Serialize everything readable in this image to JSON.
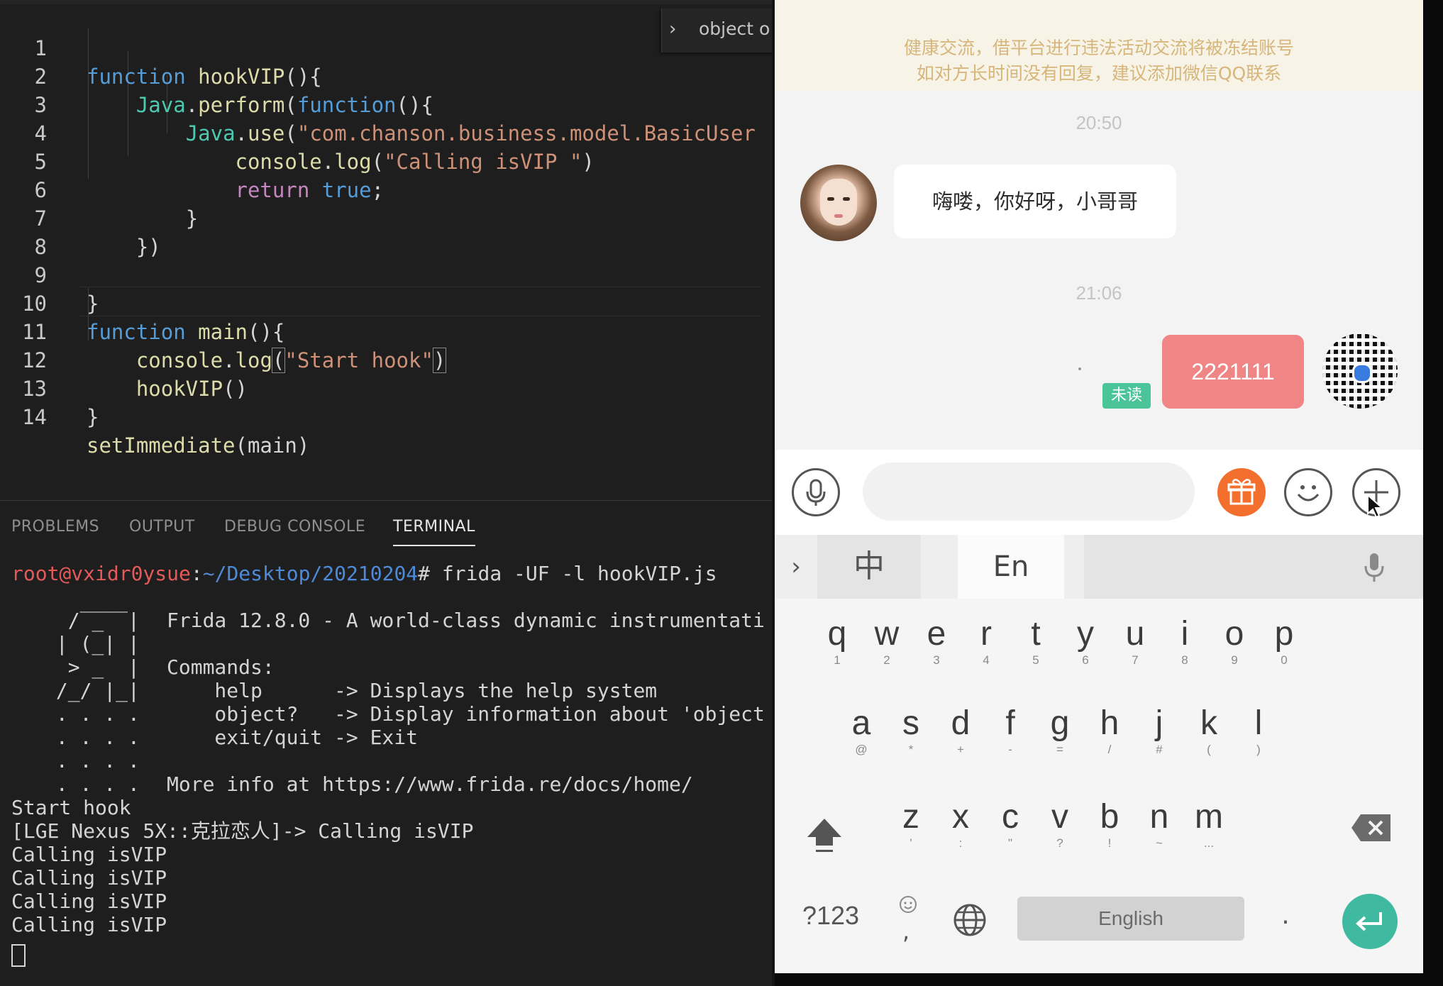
{
  "editor": {
    "breadcrumb_text": "object o",
    "lines": [
      {
        "num": "1"
      },
      {
        "num": "2"
      },
      {
        "num": "3"
      },
      {
        "num": "4"
      },
      {
        "num": "5"
      },
      {
        "num": "6"
      },
      {
        "num": "7"
      },
      {
        "num": "8"
      },
      {
        "num": "9"
      },
      {
        "num": "10"
      },
      {
        "num": "11"
      },
      {
        "num": "12"
      },
      {
        "num": "13"
      },
      {
        "num": "14"
      }
    ],
    "tokens": {
      "l1_kw": "function",
      "l1_fn": "hookVIP",
      "l1_rest": "(){",
      "l2_obj": "Java",
      "l2_dot": ".",
      "l2_fn": "perform",
      "l2_p": "(",
      "l2_kw": "function",
      "l2_rest": "(){",
      "l3_obj": "Java",
      "l3_dot": ".",
      "l3_fn": "use",
      "l3_p": "(",
      "l3_str": "\"com.chanson.business.model.BasicUser",
      "l4_obj": "console",
      "l4_dot": ".",
      "l4_fn": "log",
      "l4_p": "(",
      "l4_str": "\"Calling isVIP \"",
      "l4_rest": ")",
      "l5_kw": "return",
      "l5_sp": " ",
      "l5_val": "true",
      "l5_rest": ";",
      "l6": "}",
      "l7": "})",
      "l9": "}",
      "l10_kw": "function",
      "l10_fn": "main",
      "l10_rest": "(){",
      "l11_obj": "console",
      "l11_dot": ".",
      "l11_fn": "log",
      "l11_p": "(",
      "l11_str": "\"Start hook\"",
      "l11_rest": ")",
      "l12_fn": "hookVIP",
      "l12_rest": "()",
      "l13": "}",
      "l14_fn": "setImmediate",
      "l14_rest": "(main)"
    }
  },
  "panel": {
    "tabs": [
      "PROBLEMS",
      "OUTPUT",
      "DEBUG CONSOLE",
      "TERMINAL"
    ],
    "active_tab": "TERMINAL",
    "prompt_user": "root@vxidr0ysue",
    "prompt_sep": ":",
    "prompt_path": "~/Desktop/20210204",
    "prompt_cmd": "# frida -UF -l hookVIP.js",
    "ascii": [
      "   ____",
      "  / _  |",
      " | (_| |",
      "  > _  |",
      " /_/ |_|",
      " . . . .",
      " . . . .",
      " . . . .",
      " . . . ."
    ],
    "banner": "Frida 12.8.0 - A world-class dynamic instrumentati",
    "commands_header": "Commands:",
    "cmd_help": "    help      -> Displays the help system",
    "cmd_object": "    object?   -> Display information about 'object",
    "cmd_exit": "    exit/quit -> Exit",
    "more_info": "More info at https://www.frida.re/docs/home/",
    "output": [
      "Start hook",
      "[LGE Nexus 5X::克拉恋人]-> Calling isVIP",
      "Calling isVIP",
      "Calling isVIP",
      "Calling isVIP",
      "Calling isVIP"
    ]
  },
  "phone": {
    "notice_line1": "健康交流，借平台进行违法活动交流将被冻结账号",
    "notice_line2": "如对方长时间没有回复，建议添加微信QQ联系",
    "time1": "20:50",
    "incoming_message": "嗨喽，你好呀，小哥哥",
    "time2": "21:06",
    "outgoing_message": "2221111",
    "unread_label": "未读",
    "keyboard": {
      "lang_cn": "中",
      "lang_en": "En",
      "row1": [
        {
          "k": "q",
          "s": "1"
        },
        {
          "k": "w",
          "s": "2"
        },
        {
          "k": "e",
          "s": "3"
        },
        {
          "k": "r",
          "s": "4"
        },
        {
          "k": "t",
          "s": "5"
        },
        {
          "k": "y",
          "s": "6"
        },
        {
          "k": "u",
          "s": "7"
        },
        {
          "k": "i",
          "s": "8"
        },
        {
          "k": "o",
          "s": "9"
        },
        {
          "k": "p",
          "s": "0"
        }
      ],
      "row2": [
        {
          "k": "a",
          "s": "@"
        },
        {
          "k": "s",
          "s": "*"
        },
        {
          "k": "d",
          "s": "+"
        },
        {
          "k": "f",
          "s": "-"
        },
        {
          "k": "g",
          "s": "="
        },
        {
          "k": "h",
          "s": "/"
        },
        {
          "k": "j",
          "s": "#"
        },
        {
          "k": "k",
          "s": "("
        },
        {
          "k": "l",
          "s": ")"
        }
      ],
      "row3": [
        {
          "k": "z",
          "s": "'"
        },
        {
          "k": "x",
          "s": ":"
        },
        {
          "k": "c",
          "s": "\""
        },
        {
          "k": "v",
          "s": "?"
        },
        {
          "k": "b",
          "s": "!"
        },
        {
          "k": "n",
          "s": "~"
        },
        {
          "k": "m",
          "s": "..."
        }
      ],
      "symbols_key": "?123",
      "comma_key": ",",
      "space_label": "English",
      "period_key": "."
    }
  }
}
